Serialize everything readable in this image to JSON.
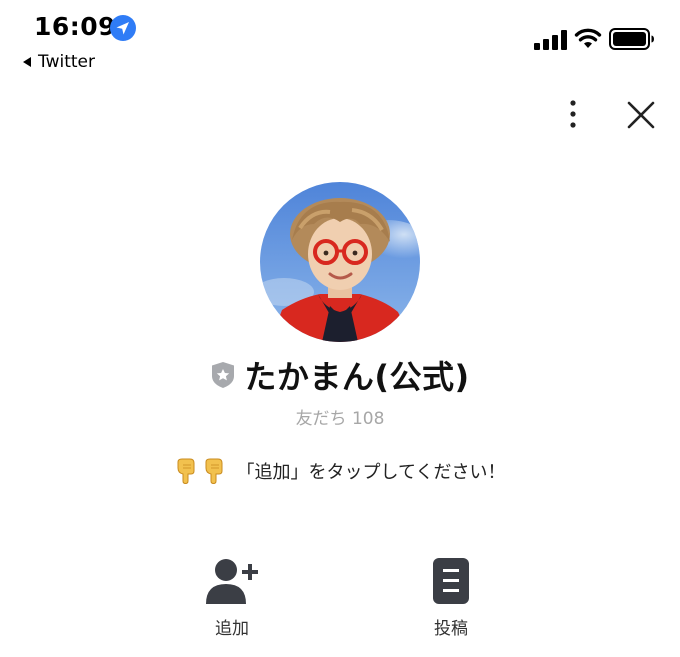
{
  "status_bar": {
    "time": "16:09",
    "back_app": "Twitter"
  },
  "icons": {
    "location": "location-arrow-icon",
    "back": "back-caret-icon",
    "signal": "cellular-signal-icon",
    "wifi": "wifi-icon",
    "battery": "battery-icon",
    "more": "more-vertical-icon",
    "close": "close-icon",
    "official_badge": "shield-star-icon",
    "add_friend": "add-friend-icon",
    "posts": "posts-icon",
    "pointing": "pointing-down-icon"
  },
  "profile": {
    "name": "たかまん(公式)",
    "friends": "友だち 108",
    "status_message": "「追加」をタップしてください！"
  },
  "actions": {
    "add_label": "追加",
    "posts_label": "投稿"
  },
  "colors": {
    "icon_dark": "#3b3e45",
    "location_blue": "#2f7cf6",
    "badge_gray": "#a7a9ad",
    "muted_text": "#a7a7a7"
  }
}
